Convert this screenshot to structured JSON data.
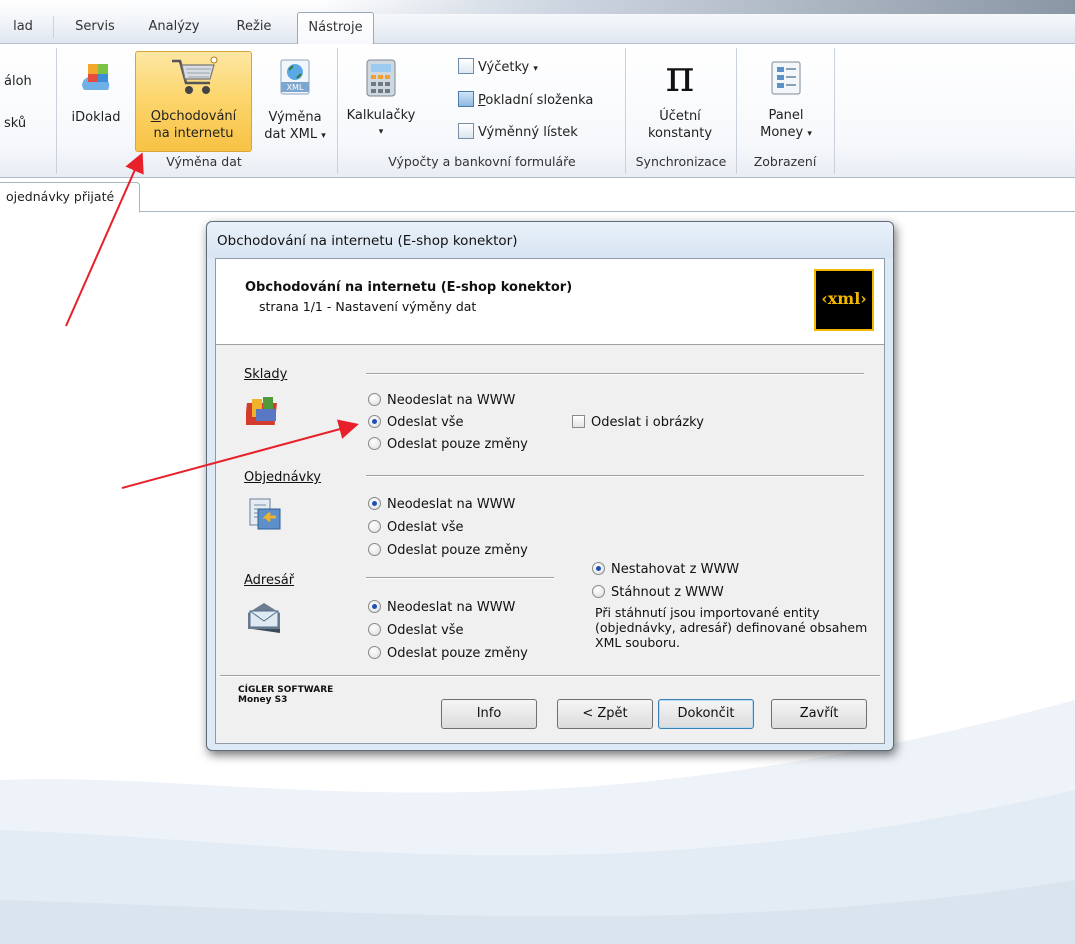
{
  "ribbon": {
    "tabs": [
      "lad",
      "Servis",
      "Analýzy",
      "Režie",
      "Nástroje"
    ],
    "active_tab": "Nástroje",
    "left_partial": {
      "line1": "áloh",
      "line2": "sků"
    },
    "buttons": {
      "idoklad": "iDoklad",
      "eshop_line1": "Obchodování",
      "eshop_line2": "na internetu",
      "xml_line1": "Výměna",
      "xml_line2": "dat XML",
      "calc": "Kalkulačky",
      "vycetky": "Výčetky",
      "pokladni": "Pokladní složenka",
      "vymenny": "Výměnný lístek",
      "ucetni_line1": "Účetní",
      "ucetni_line2": "konstanty",
      "panel_line1": "Panel",
      "panel_line2": "Money"
    },
    "groups": {
      "vymena": "Výměna dat",
      "vypocty": "Výpočty a bankovní formuláře",
      "sync": "Synchronizace",
      "zobrazeni": "Zobrazení"
    }
  },
  "doc_tab": "ojednávky přijaté",
  "dialog": {
    "title": "Obchodování na internetu (E-shop konektor)",
    "header_title": "Obchodování na internetu (E-shop konektor)",
    "header_subtitle": "strana 1/1 - Nastavení výměny dat",
    "logo_text": "‹xml›",
    "sections": {
      "sklady": "Sklady",
      "objednavky": "Objednávky",
      "adresar": "Adresář"
    },
    "sklady_options": [
      "Neodeslat na WWW",
      "Odeslat vše",
      "Odeslat pouze změny"
    ],
    "sklady_selected": 1,
    "sklady_checkbox": "Odeslat i obrázky",
    "objednavky_options": [
      "Neodeslat na WWW",
      "Odeslat vše",
      "Odeslat pouze změny"
    ],
    "objednavky_selected": 0,
    "download_options": [
      "Nestahovat z WWW",
      "Stáhnout z WWW"
    ],
    "download_selected": 0,
    "adresar_options": [
      "Neodeslat na WWW",
      "Odeslat vše",
      "Odeslat pouze změny"
    ],
    "adresar_selected": 0,
    "note": "Při stáhnutí jsou importované entity (objednávky, adresář) definované obsahem XML souboru.",
    "brand_line1": "CÍGLER SOFTWARE",
    "brand_line2": "Money S3",
    "buttons": {
      "info": "Info",
      "back": "< Zpět",
      "finish": "Dokončit",
      "close": "Zavřít"
    }
  },
  "colors": {
    "selected_button": "#fcd66e",
    "arrow": "#e8202a",
    "dialog_frame": "#dde9f5",
    "radio_dot": "#1d4fb4"
  }
}
